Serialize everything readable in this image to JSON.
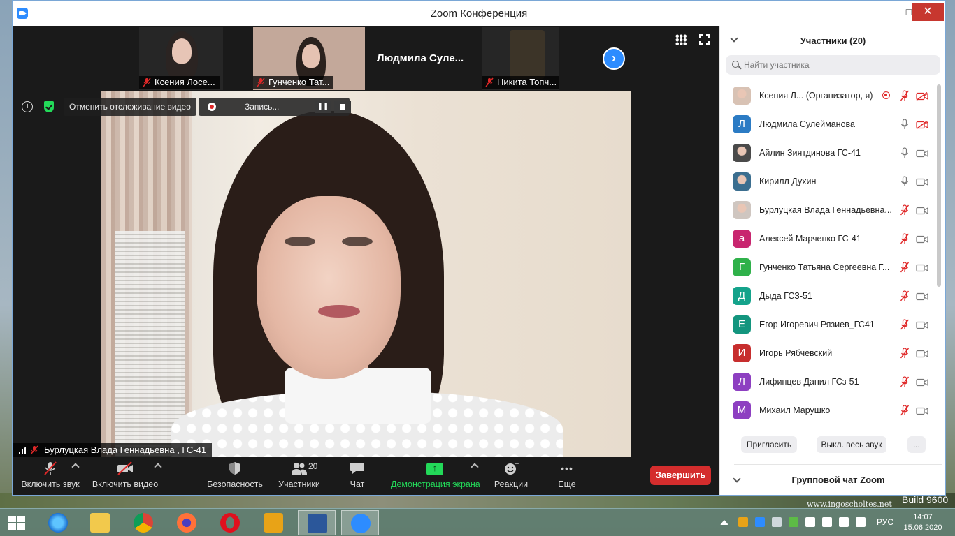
{
  "window": {
    "title": "Zoom Конференция",
    "minimize": "—",
    "maximize": "□",
    "close": "✕"
  },
  "desktop": {
    "watermark": "www.ingoscholtes.net",
    "build": "Build 9600"
  },
  "strip": {
    "thumbs": [
      {
        "name": "Ксения Лосе..."
      },
      {
        "name": "Гунченко Тат..."
      },
      {
        "name": "Людмила  Суле..."
      },
      {
        "name": "Никита Топч..."
      }
    ]
  },
  "overlay": {
    "tracking": "Отменить отслеживание видео",
    "recording": "Запись...",
    "pause": "❚❚"
  },
  "speaker": {
    "name": "Бурлуцкая Влада Геннадьевна , ГС-41"
  },
  "toolbar": {
    "mute": "Включить звук",
    "video": "Включить видео",
    "security": "Безопасность",
    "participants": "Участники",
    "participants_count": "20",
    "chat": "Чат",
    "share": "Демонстрация экрана",
    "reactions": "Реакции",
    "more": "Еще",
    "more_glyph": "•••",
    "end": "Завершить"
  },
  "panel": {
    "title": "Участники (20)",
    "search_placeholder": "Найти участника",
    "participants": [
      {
        "name": "Ксения Л...",
        "role": "(Организатор, я)",
        "avatar_letter": "",
        "avatar_color": "#d8c2b4",
        "photo": true,
        "mic": "off",
        "cam": "off",
        "recording": true
      },
      {
        "name": "Людмила Сулейманова",
        "role": "",
        "avatar_letter": "Л",
        "avatar_color": "#2b7bc4",
        "photo": false,
        "mic": "on",
        "cam": "off"
      },
      {
        "name": "Айлин Зиятдинова ГС-41",
        "role": "",
        "avatar_letter": "",
        "avatar_color": "#4a4a4a",
        "photo": true,
        "mic": "on",
        "cam": "on"
      },
      {
        "name": "Кирилл Духин",
        "role": "",
        "avatar_letter": "",
        "avatar_color": "#3b6e8f",
        "photo": true,
        "mic": "on",
        "cam": "on"
      },
      {
        "name": " Бурлуцкая Влада Геннадьевна...",
        "role": "",
        "avatar_letter": "",
        "avatar_color": "#cfc6c0",
        "photo": true,
        "mic": "off",
        "cam": "on"
      },
      {
        "name": "Алексей Марченко ГС-41",
        "role": "",
        "avatar_letter": "а",
        "avatar_color": "#c8266f",
        "photo": false,
        "mic": "off",
        "cam": "on"
      },
      {
        "name": "Гунченко Татьяна Сергеевна Г...",
        "role": "",
        "avatar_letter": "Г",
        "avatar_color": "#2fb14a",
        "photo": false,
        "mic": "off",
        "cam": "on"
      },
      {
        "name": "Дыда ГСЗ-51",
        "role": "",
        "avatar_letter": "Д",
        "avatar_color": "#14a38b",
        "photo": false,
        "mic": "off",
        "cam": "on"
      },
      {
        "name": "Егор Игоревич Рязиев_ГС41",
        "role": "",
        "avatar_letter": "Е",
        "avatar_color": "#13957e",
        "photo": false,
        "mic": "off",
        "cam": "on"
      },
      {
        "name": "Игорь Рябчевский",
        "role": "",
        "avatar_letter": "И",
        "avatar_color": "#c72e2e",
        "photo": false,
        "mic": "off",
        "cam": "on"
      },
      {
        "name": "Лифинцев Данил ГСз-51",
        "role": "",
        "avatar_letter": "Л",
        "avatar_color": "#8d3fc1",
        "photo": false,
        "mic": "off",
        "cam": "on"
      },
      {
        "name": "Михаил Марушко",
        "role": "",
        "avatar_letter": "М",
        "avatar_color": "#8d3fc1",
        "photo": false,
        "mic": "off",
        "cam": "on"
      }
    ],
    "invite": "Пригласить",
    "mute_all": "Выкл. весь звук",
    "more": "...",
    "chat_title": "Групповой чат Zoom"
  },
  "taskbar": {
    "lang": "РУС",
    "time": "14:07",
    "date": "15.06.2020"
  },
  "colors": {
    "accent": "#2d8cff",
    "end": "#d42d2d",
    "share": "#23d959",
    "mic_off": "#e02828"
  }
}
